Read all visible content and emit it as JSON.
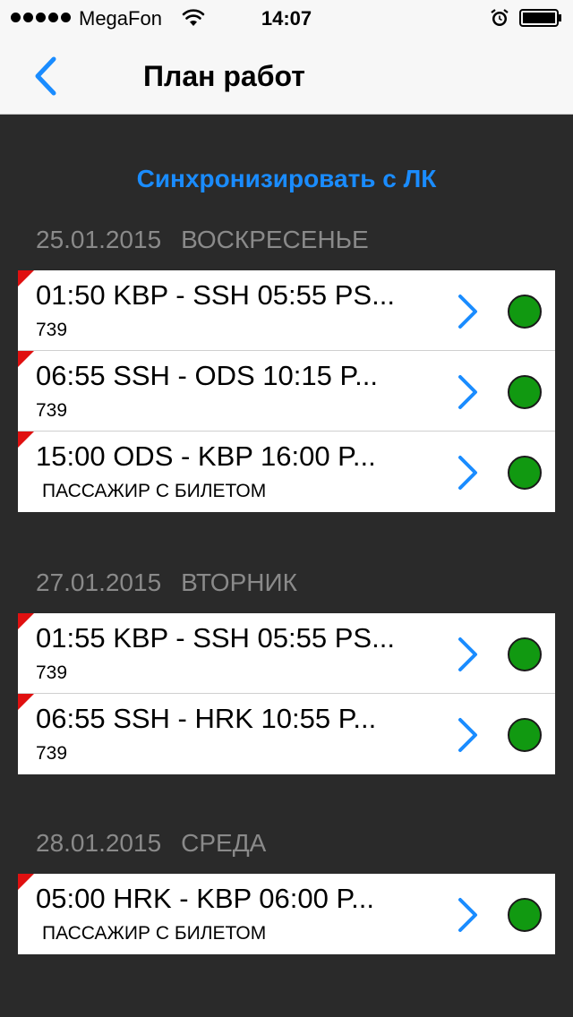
{
  "status_bar": {
    "carrier": "MegaFon",
    "time": "14:07"
  },
  "nav": {
    "title": "План работ"
  },
  "sync_label": "Синхронизировать с ЛК",
  "colors": {
    "accent": "#1a8cff",
    "status_ok": "#119911",
    "flag": "#e01010"
  },
  "sections": [
    {
      "date": "25.01.2015",
      "weekday": "ВОСКРЕСЕНЬЕ",
      "rows": [
        {
          "title": "01:50 KBP - SSH 05:55 PS...",
          "sub": "739"
        },
        {
          "title": "06:55 SSH - ODS 10:15 P...",
          "sub": "739"
        },
        {
          "title": "15:00 ODS - KBP 16:00 P...",
          "sub": "ПАССАЖИР С БИЛЕТОМ"
        }
      ]
    },
    {
      "date": "27.01.2015",
      "weekday": "ВТОРНИК",
      "rows": [
        {
          "title": "01:55 KBP - SSH 05:55 PS...",
          "sub": "739"
        },
        {
          "title": "06:55 SSH - HRK 10:55 P...",
          "sub": "739"
        }
      ]
    },
    {
      "date": "28.01.2015",
      "weekday": "СРЕДА",
      "rows": [
        {
          "title": "05:00 HRK - KBP 06:00 P...",
          "sub": "ПАССАЖИР С БИЛЕТОМ"
        }
      ]
    }
  ]
}
